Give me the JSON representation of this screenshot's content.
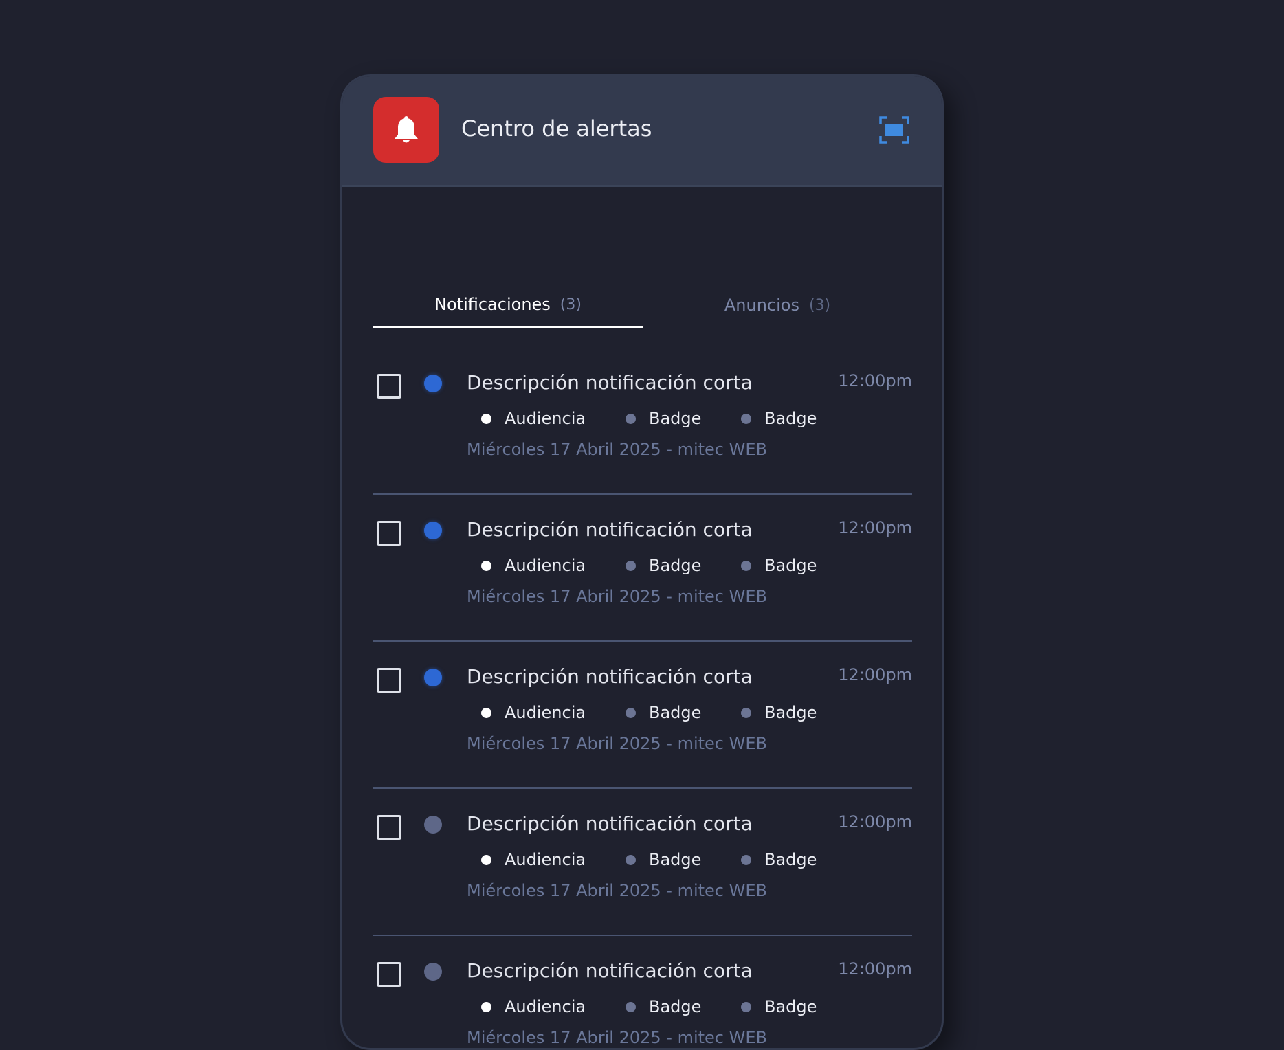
{
  "header": {
    "title": "Centro de alertas",
    "app_icon": "bell-icon",
    "expand_icon": "fullscreen-icon",
    "accent_color": "#d42d2d"
  },
  "tabs": [
    {
      "label": "Notificaciones",
      "count": "(3)",
      "active": true
    },
    {
      "label": "Anuncios",
      "count": "(3)",
      "active": false
    }
  ],
  "notifications": [
    {
      "title": "Descripción notificación corta",
      "time": "12:00pm",
      "unread": true,
      "badges": [
        "Audiencia",
        "Badge",
        "Badge"
      ],
      "meta": "Miércoles 17 Abril 2025 - mitec WEB"
    },
    {
      "title": "Descripción notificación corta",
      "time": "12:00pm",
      "unread": true,
      "badges": [
        "Audiencia",
        "Badge",
        "Badge"
      ],
      "meta": "Miércoles 17 Abril 2025 - mitec WEB"
    },
    {
      "title": "Descripción notificación corta",
      "time": "12:00pm",
      "unread": true,
      "badges": [
        "Audiencia",
        "Badge",
        "Badge"
      ],
      "meta": "Miércoles 17 Abril 2025 - mitec WEB"
    },
    {
      "title": "Descripción notificación corta",
      "time": "12:00pm",
      "unread": false,
      "badges": [
        "Audiencia",
        "Badge",
        "Badge"
      ],
      "meta": "Miércoles 17 Abril 2025 - mitec WEB"
    },
    {
      "title": "Descripción notificación corta",
      "time": "12:00pm",
      "unread": false,
      "badges": [
        "Audiencia",
        "Badge",
        "Badge"
      ],
      "meta": "Miércoles 17 Abril 2025 - mitec WEB"
    }
  ],
  "colors": {
    "unread_dot": "#2d68d4",
    "read_dot": "#5e6788",
    "background": "#1f212e",
    "header_bg": "#333a4e"
  }
}
